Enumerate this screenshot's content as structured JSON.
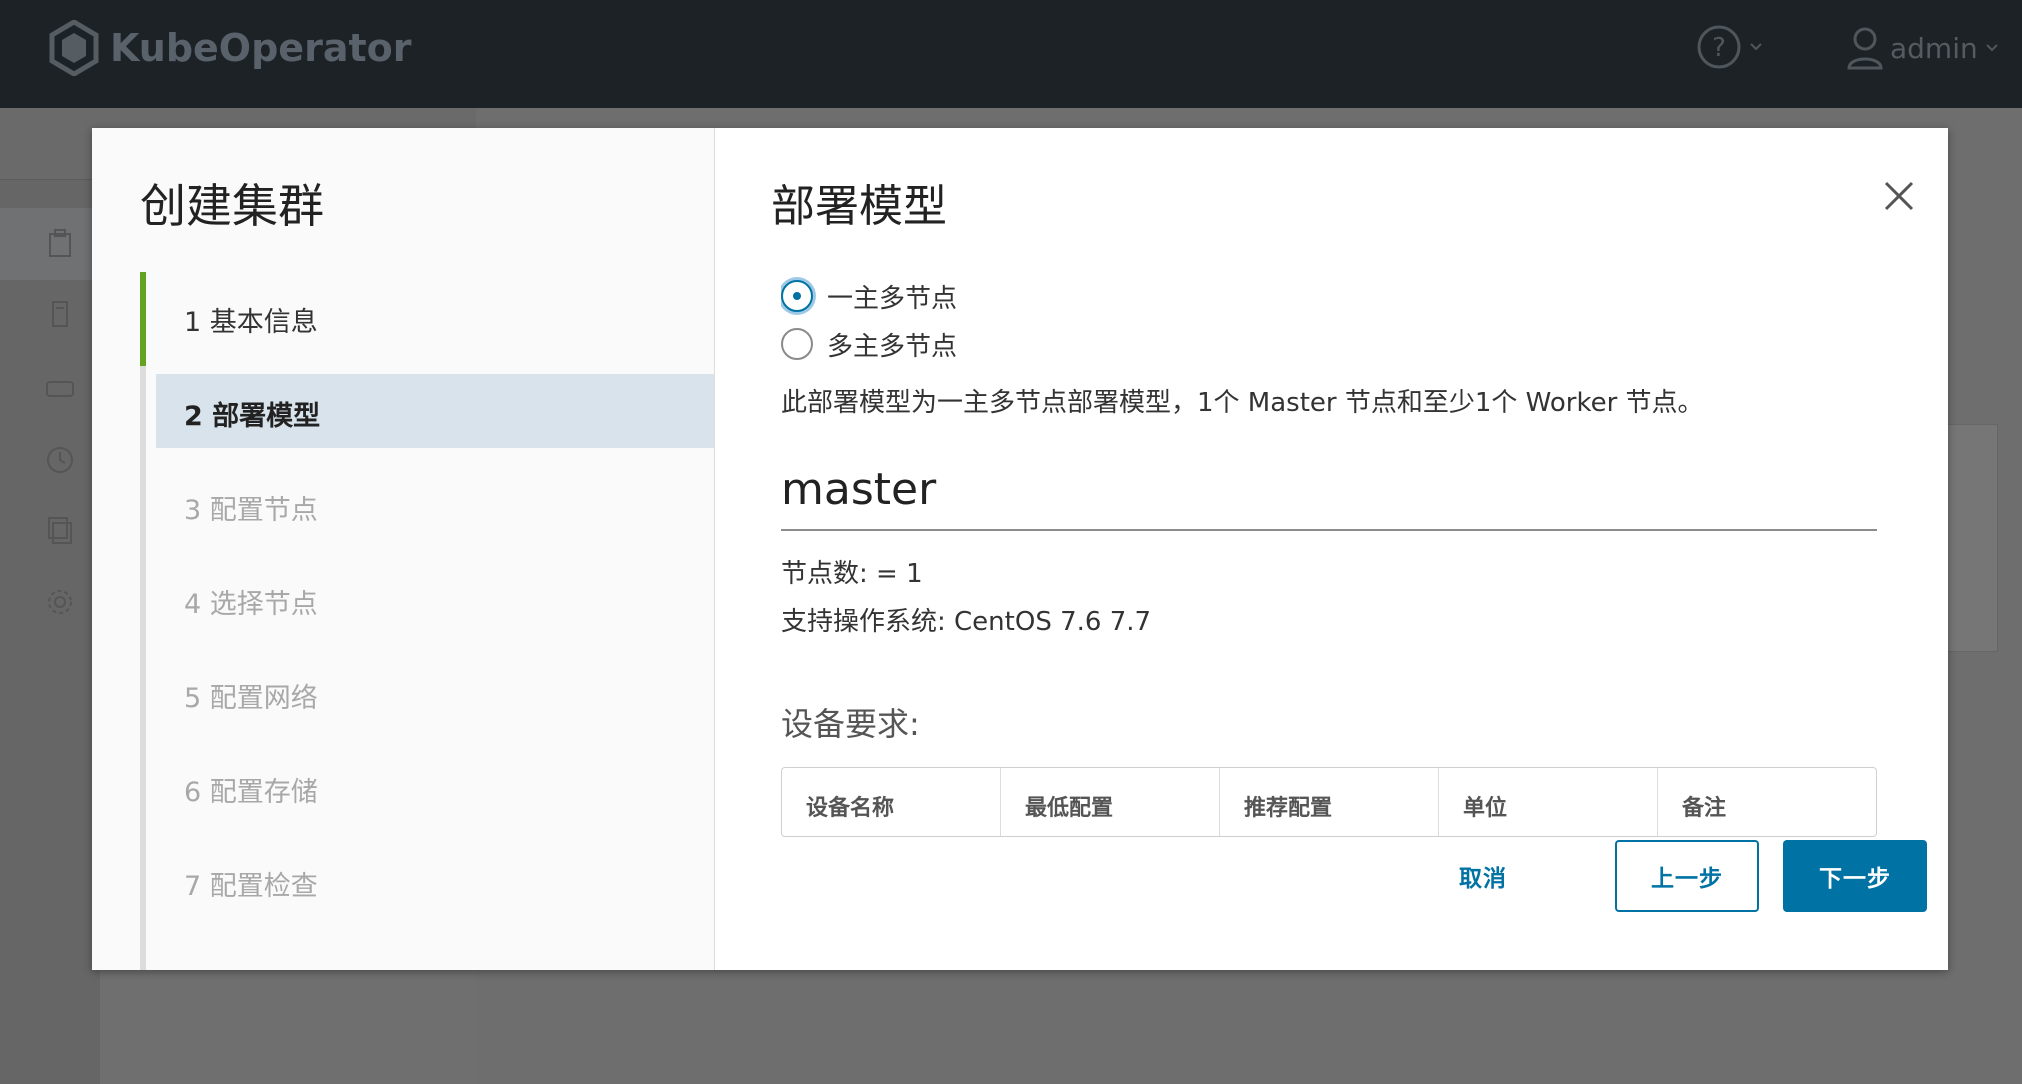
{
  "app": {
    "brand": "KubeOperator",
    "user": "admin"
  },
  "wizard": {
    "title": "创建集群",
    "steps": [
      {
        "label": "1 基本信息",
        "state": "done"
      },
      {
        "label": "2 部署模型",
        "state": "active"
      },
      {
        "label": "3 配置节点",
        "state": "pending"
      },
      {
        "label": "4 选择节点",
        "state": "pending"
      },
      {
        "label": "5 配置网络",
        "state": "pending"
      },
      {
        "label": "6 配置存储",
        "state": "pending"
      },
      {
        "label": "7 配置检查",
        "state": "pending"
      }
    ]
  },
  "content": {
    "title": "部署模型",
    "options": [
      {
        "label": "一主多节点",
        "selected": true
      },
      {
        "label": "多主多节点",
        "selected": false
      }
    ],
    "description": "此部署模型为一主多节点部署模型，1个 Master 节点和至少1个 Worker 节点。",
    "role": "master",
    "node_count": "节点数: = 1",
    "os_support": "支持操作系统: CentOS  7.6  7.7",
    "requirements_label": "设备要求:",
    "table_headers": [
      "设备名称",
      "最低配置",
      "推荐配置",
      "单位",
      "备注"
    ]
  },
  "footer": {
    "cancel": "取消",
    "prev": "上一步",
    "next": "下一步"
  },
  "colors": {
    "primary": "#0072a3",
    "done_bar": "#62a420",
    "active_bg": "#d8e3eb",
    "header_bg": "#1d2227"
  }
}
